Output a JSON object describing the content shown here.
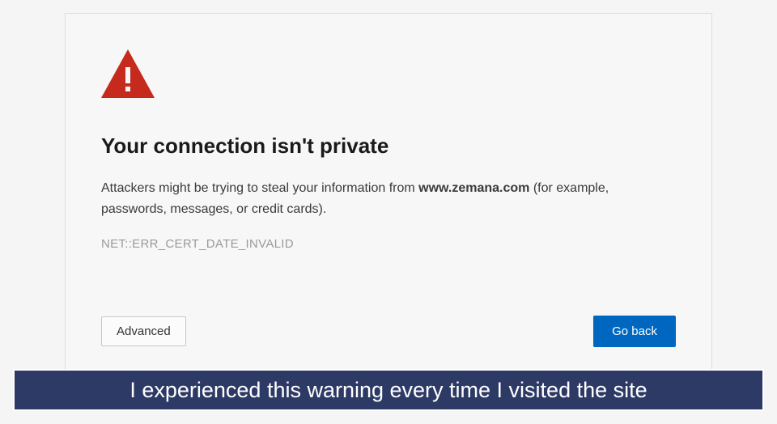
{
  "error_page": {
    "heading": "Your connection isn't private",
    "description_prefix": "Attackers might be trying to steal your information from ",
    "domain": "www.zemana.com",
    "description_suffix": " (for example, passwords, messages, or credit cards).",
    "error_code": "NET::ERR_CERT_DATE_INVALID",
    "buttons": {
      "advanced": "Advanced",
      "go_back": "Go back"
    }
  },
  "caption": "I experienced this warning every time I visited the site"
}
